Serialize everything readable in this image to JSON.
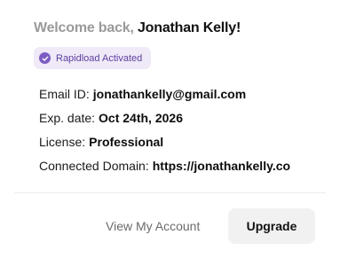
{
  "header": {
    "welcome_prefix": "Welcome back,",
    "user_name": "Jonathan Kelly!"
  },
  "badge": {
    "label": "Rapidload Activated",
    "icon": "check-circle-icon",
    "color": "#7c5cc4",
    "background": "#efe9f8"
  },
  "account": {
    "email_label": "Email ID:",
    "email_value": "jonathankelly@gmail.com",
    "exp_label": "Exp. date:",
    "exp_value": "Oct 24th, 2026",
    "license_label": "License:",
    "license_value": "Professional",
    "domain_label": "Connected Domain:",
    "domain_value": "https://jonathankelly.co"
  },
  "actions": {
    "view_account_label": "View My Account",
    "upgrade_label": "Upgrade"
  }
}
